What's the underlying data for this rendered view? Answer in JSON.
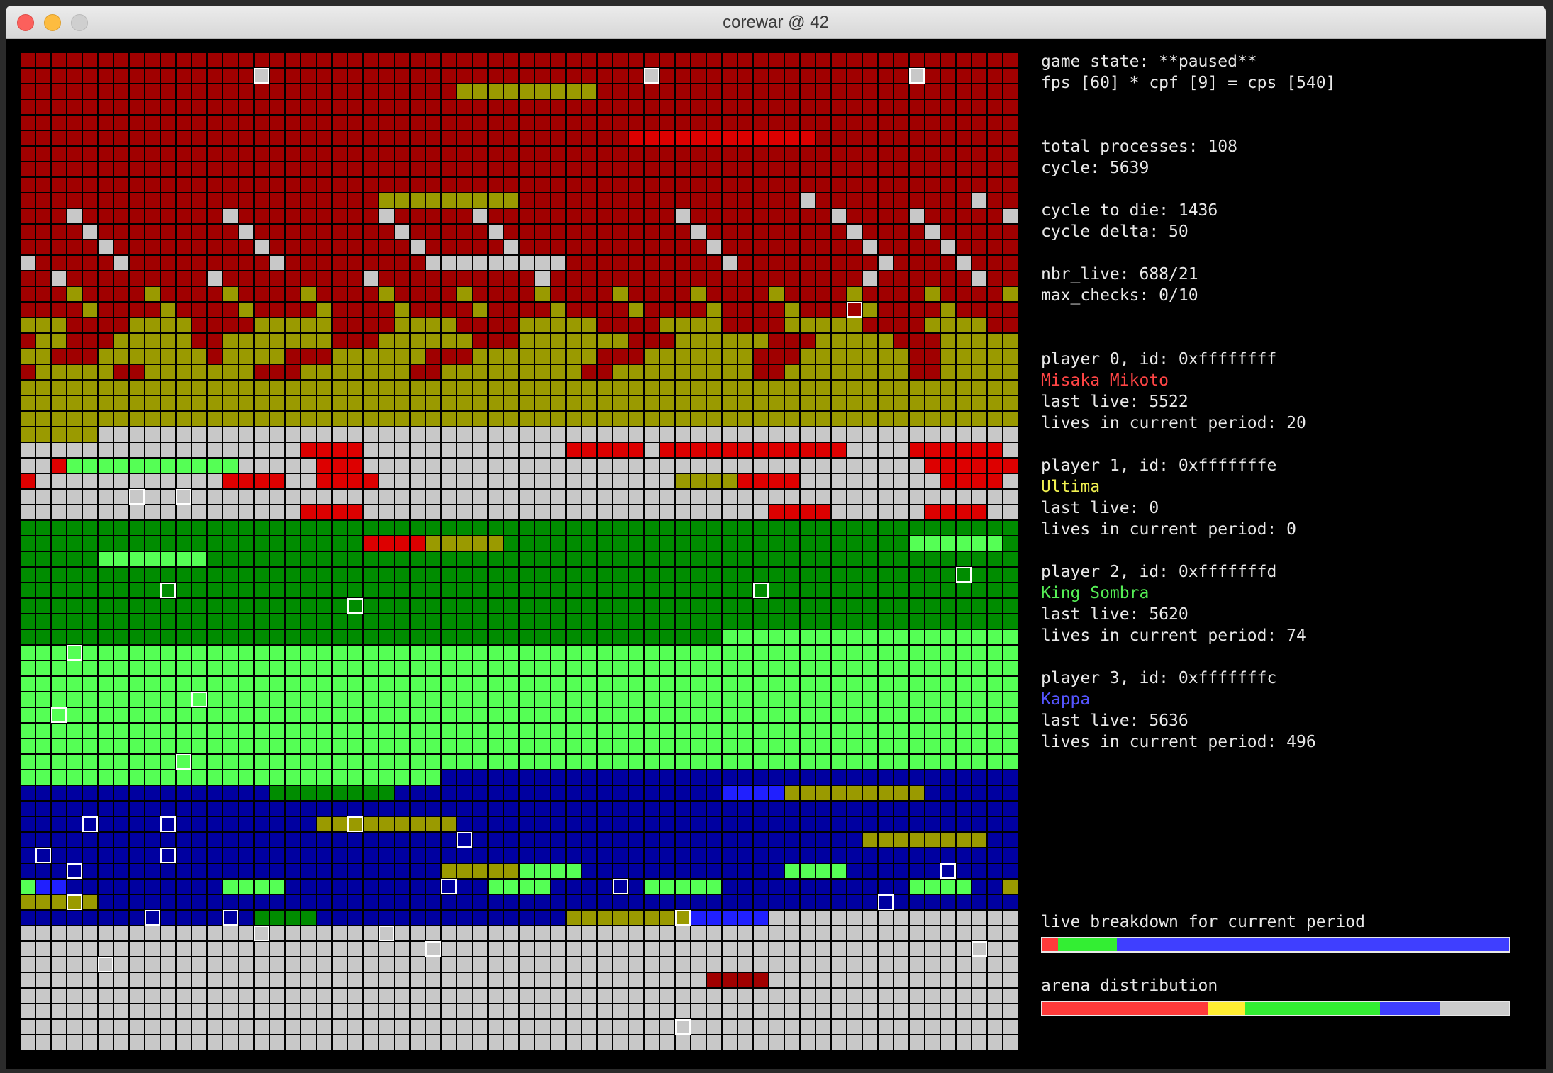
{
  "window": {
    "title": "corewar @ 42"
  },
  "status": {
    "game_state": "game state: **paused**",
    "rates": "fps [60] * cpf [9] = cps [540]",
    "total_processes": "total processes: 108",
    "cycle": "cycle: 5639",
    "cycle_to_die": "cycle to die: 1436",
    "cycle_delta": "cycle delta: 50",
    "nbr_live": "nbr_live: 688/21",
    "max_checks": "max_checks: 0/10"
  },
  "players": [
    {
      "header": "player 0, id: 0xffffffff",
      "name": "Misaka Mikoto",
      "color": "#ff4545",
      "last_live": "last live: 5522",
      "lives_period": "lives in current period: 20"
    },
    {
      "header": "player 1, id: 0xfffffffe",
      "name": "Ultima",
      "color": "#f0f050",
      "last_live": "last live: 0",
      "lives_period": "lives in current period: 0"
    },
    {
      "header": "player 2, id: 0xfffffffd",
      "name": "King Sombra",
      "color": "#55ee55",
      "last_live": "last live: 5620",
      "lives_period": "lives in current period: 74"
    },
    {
      "header": "player 3, id: 0xfffffffc",
      "name": "Kappa",
      "color": "#5555ff",
      "last_live": "last live: 5636",
      "lives_period": "lives in current period: 496"
    }
  ],
  "live_breakdown": {
    "label": "live breakdown for current period",
    "segments": [
      {
        "fraction": 0.034,
        "color": "#ff3b3b"
      },
      {
        "fraction": 0.0,
        "color": "#ffee33"
      },
      {
        "fraction": 0.125,
        "color": "#33ee33"
      },
      {
        "fraction": 0.841,
        "color": "#3f3fff"
      }
    ]
  },
  "arena_distribution": {
    "label": "arena distribution",
    "segments": [
      {
        "fraction": 0.355,
        "color": "#ff3b3b"
      },
      {
        "fraction": 0.078,
        "color": "#ffee33"
      },
      {
        "fraction": 0.29,
        "color": "#33ee33"
      },
      {
        "fraction": 0.13,
        "color": "#3f3fff"
      },
      {
        "fraction": 0.147,
        "color": "#cccccc"
      }
    ]
  },
  "arena": {
    "palette": {
      "R": "#a00000",
      "r": "#dd0000",
      "o": "#9a9a00",
      "g": "#008c00",
      "l": "#55ff55",
      "b": "#0000a0",
      "B": "#2020ff",
      "w": "#c8c8c8",
      "x": "#9a9a00"
    },
    "rows": [
      "RRRRRRRRRRRRRRRRRRRRRRRRRRRRRRRRRRRRRRRRRRRRRRRRRRRRRRRRRRRRRRRR",
      "RRRRRRRRRRRRRRRwRRRRRRRRRRRRRRRRRRRRRRRRwRRRRRRRRRRRRRRRRwRRRRRR",
      "RRRRRRRRRRRRRRRRRRRRRRRRRRRRoooooooooRRRRRRRRRRRRRRRRRRRRRRRRRRR",
      "RRRRRRRRRRRRRRRRRRRRRRRRRRRRRRRRRRRRRRRRRRRRRRRRRRRRRRRRRRRRRRRR",
      "RRRRRRRRRRRRRRRRRRRRRRRRRRRRRRRRRRRRRRRRRRRRRRRRRRRRRRRRRRRRRRRR",
      "RRRRRRRRRRRRRRRRRRRRRRRRRRRRRRRRRRRRRRRrrrrrrrrrrrrRRRRRRRRRRRRR",
      "RRRRRRRRRRRRRRRRRRRRRRRRRRRRRRRRRRRRRRRRRRRRRRRRRRRRRRRRRRRRRRRR",
      "RRRRRRRRRRRRRRRRRRRRRRRRRRRRRRRRRRRRRRRRRRRRRRRRRRRRRRRRRRRRRRRR",
      "RRRRRRRRRRRRRRRRRRRRRRRRRRRRRRRRRRRRRRRRRRRRRRRRRRRRRRRRRRRRRRRR",
      "RRRRRRRRRRRRRRRRRRRRRRRoooooooooRRRRRRRRRRRRRRRRRRwRRRRRRRRRRwRR",
      "RRRwRRRRRRRRRwRRRRRRRRRwRRRRRwRRRRRRRRRRRRwRRRRRRRRRwRRRRwRRRRRw",
      "RRRRwRRRRRRRRRwRRRRRRRRRwRRRRRwRRRRRRRRRRRRwRRRRRRRRRwRRRRwRRRRR",
      "RRRRRwRRRRRRRRRwRRRRRRRRRwRRRRRwRRRRRRRRRRRRwRRRRRRRRRwRRRRwRRRR",
      "wRRRRRwRRRRRRRRRwRRRRRRRRRwwwwwwwwwRRRRRRRRRRwRRRRRRRRRwRRRRwRRR",
      "RRwRRRRRRRRRwRRRRRRRRRwRRRRRRRRRRwRRRRRRRRRRRRRRRRRRRRwRRRRRRwRR",
      "RRRoRRRRoRRRRoRRRRoRRRRoRRRRoRRRRoRRRRoRRRRoRRRRoRRRRoRRRRoRRRRo",
      "RRRRoRRRRoRRRRoRRRRoRRRRoRRRRoRRRRoRRRRoRRRRoRRRRoRRRRoRRRRoRRRR",
      "oooRRRRooooRRRRoooooRRRRooooRRRRoooooRRRRooooRRRRoooooRRRRooooRR",
      "RooRRRoooooRRoooooooRRRooooooRRRoooooooRRRooooooRRRoooooRRRooooo",
      "ooRRRoooooooRooooRRRooooooRRRooooooooRRRoooooooRRRoooooooRRooooo",
      "RoooooRRoooooooRRRoooooooRRoooooooooRRoooooooooRRooooooooRRooooo",
      "oooooooooooooooooooooooooooooooooooooooooooooooooooooooooooooooo",
      "oooooooooooooooooooooooooooooooooooooooooooooooooooooooooooooooo",
      "oooooooooooooooooooooooooooooooooooooooooooooooooooooooooooooooo",
      "ooooowwwwwwwwwwwwwwwwwwwwwwwwwwwwwwwwwwwwwwwwwwwwwwwwwwwwwwwwwww",
      "wwwwwwwwwwwwwwwwwwrrrrwwwwwwwwwwwwwrrrrrwrrrrrrrrrrrrwwwwrrrrrrww",
      "wwrlllllllllllwwwwwrrrwwwwwwwwwwwwwwwwwwwwwwwwwwwwwwwwwwwwrrrrrrr",
      "rwwwwwwwwwwwwrrrrwwrrrrwwwwwwwwwwwwwwwwwwwoooorrrrwwwwwwwwwrrrrww",
      "wwwwwwwwwwwwwwwwwwwwwwwwwwwwwwwwwwwwwwwwwwwwwwwwwwwwwwwwwwwwwwww",
      "wwwwwwwwwwwwwwwwwwrrrrwwwwwwwwwwwwwwwwwwwwwwwwwwrrrrwwwwwwrrrrwww",
      "gggggggggggggggggggggggggggggggggggggggggggggggggggggggggggggggg",
      "ggggggggggggggggggggggrrrroooooggggggggggggggggggggggggggllllllgg",
      "ggggglllllllgggggggggggggggggggggggggggggggggggggggggggggggggggg",
      "gggggggggggggggggggggggggggggggggggggggggggggggggggggggggggggggg",
      "gggggggggggggggggggggggggggggggggggggggggggggggggggggggggggggggg",
      "gggggggggggggggggggggggggggggggggggggggggggggggggggggggggggggggg",
      "gggggggggggggggggggggggggggggggggggggggggggggggggggggggggggggggg",
      "gggggggggggggggggggggggggggggggggggggggggggggllllllllllllllllllll",
      "llllllllllllllllllllllllllllllllllllllllllllllllllllllllllllllll",
      "llllllllllllllllllllllllllllllllllllllllllllllllllllllllllllllll",
      "llllllllllllllllllllllllllllllllllllllllllllllllllllllllllllllll",
      "llllllllllllllllllllllllllllllllllllllllllllllllllllllllllllllll",
      "llllllllllllllllllllllllllllllllllllllllllllllllllllllllllllllll",
      "llllllllllllllllllllllllllllllllllllllllllllllllllllllllllllllll",
      "llllllllllllllllllllllllllllllllllllllllllllllllllllllllllllllll",
      "llllllllllllllllllllllllllllllllllllllllllllllllllllllllllllllll",
      "lllllllllllllllllllllllllllbbbbbbbbbbbbbbbbbbbbbbbbbbbbbbbbbbbbbb",
      "bbbbbbbbbbbbbbbbggggggggbbbbbbbbbbbbbbbbbbbbbBBBBooooooooobbbbbbbb",
      "bbbbbbbbbbbbbbbbbbbbbbbbbbbbbbbbbbbbbbbbbbbbbbbbbbbbbbbbbbbbbbbb",
      "bbbbbbbbbbbbbbbbbbbooooooooobbbbbbbbbbbbbbbbbbbbbbbbbbbbbbbbbbbb",
      "bbbbbbbbbbbbbbbbbbbbbbbbbbbbbbbbbbbbbbbbbbbbbbbbbbbbbboooooooobb",
      "bbbbbbbbbbbbbbbbbbbbbbbbbbbbbbbbbbbbbbbbbbbbbbbbbbbbbbbbbbbbbbbb",
      "bbbbbbbbbbbbbbbbbbbbbbbbbbbooooollllbbbbbbbbbbbbbllllbbbbbbbbbbbb",
      "lBBbbbbbbbbbbllllbbbbbbbbbbbbbllllbbbbbblllllbbbbbbbbbbbbllllbbo",
      "ooooobbbbbbbbbbbbbbbbbbbbbbbbbbbbbbbbbbbbbbbbbbbbbbbbbbbbbbbbbbb",
      "bbbbbbbbbbbbbbbggggbbbbbbbbbbbbbbbbooooooooBBBBBwwwwwwwwwwwwwwwww",
      "wwwwwwwwwwwwwwwwwwwwwwwwwwwwwwwwwwwwwwwwwwwwwwwwwwwwwwwwwwwwwwww",
      "wwwwwwwwwwwwwwwwwwwwwwwwwwwwwwwwwwwwwwwwwwwwwwwwwwwwwwwwwwwwwwww",
      "wwwwwwwwwwwwwwwwwwwwwwwwwwwwwwwwwwwwwwwwwwwwwwwwwwwwwwwwwwwwwwww",
      "wwwwwwwwwwwwwwwwwwwwwwwwwwwwwwwwwwwwwwwwwwwwRRRRwwwwwwwwwwwwwwwww",
      "wwwwwwwwwwwwwwwwwwwwwwwwwwwwwwwwwwwwwwwwwwwwwwwwwwwwwwwwwwwwwwww",
      "wwwwwwwwwwwwwwwwwwwwwwwwwwwwwwwwwwwwwwwwwwwwwwwwwwwwwwwwwwwwwwww",
      "wwwwwwwwwwwwwwwwwwwwwwwwwwwwwwwwwwwwwwwwwwwwwwwwwwwwwwwwwwwwwwww",
      "wwwwwwwwwwwwwwwwwwwwwwwwwwwwwwwwwwwwwwwwwwwwwwwwwwwwwwwwwwwwwwww"
    ],
    "process_cells": [
      [
        1,
        15
      ],
      [
        1,
        40
      ],
      [
        1,
        57
      ],
      [
        16,
        53
      ],
      [
        28,
        7
      ],
      [
        28,
        10
      ],
      [
        33,
        60
      ],
      [
        34,
        9
      ],
      [
        35,
        21
      ],
      [
        34,
        47
      ],
      [
        38,
        3
      ],
      [
        41,
        11
      ],
      [
        42,
        2
      ],
      [
        45,
        10
      ],
      [
        49,
        4
      ],
      [
        49,
        9
      ],
      [
        49,
        21
      ],
      [
        50,
        28
      ],
      [
        51,
        1
      ],
      [
        51,
        9
      ],
      [
        52,
        3
      ],
      [
        52,
        59
      ],
      [
        53,
        27
      ],
      [
        53,
        38
      ],
      [
        54,
        3
      ],
      [
        54,
        55
      ],
      [
        55,
        8
      ],
      [
        55,
        13
      ],
      [
        55,
        42
      ],
      [
        56,
        15
      ],
      [
        56,
        23
      ],
      [
        57,
        26
      ],
      [
        57,
        61
      ],
      [
        58,
        5
      ],
      [
        62,
        42
      ]
    ]
  }
}
